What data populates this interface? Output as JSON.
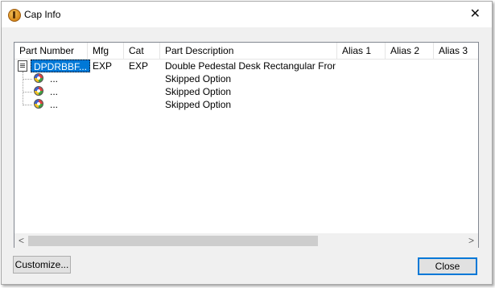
{
  "window": {
    "title": "Cap Info"
  },
  "columns": [
    "Part Number",
    "Mfg",
    "Cat",
    "Part Description",
    "Alias 1",
    "Alias 2",
    "Alias 3"
  ],
  "rows": [
    {
      "part_number": "DPDRBBF...",
      "mfg": "EXP",
      "cat": "EXP",
      "description": "Double Pedestal Desk Rectangular Front ..."
    },
    {
      "part_number": "...",
      "description": "Skipped Option"
    },
    {
      "part_number": "...",
      "description": "Skipped Option"
    },
    {
      "part_number": "...",
      "description": "Skipped Option"
    }
  ],
  "buttons": {
    "customize": "Customize...",
    "close": "Close"
  },
  "icons": {
    "app": "cap-info-app-icon",
    "root": "document-icon",
    "option": "option-ball-icon",
    "close": "close-icon"
  },
  "colors": {
    "selection": "#0078d7",
    "default_button_border": "#0078d7"
  }
}
